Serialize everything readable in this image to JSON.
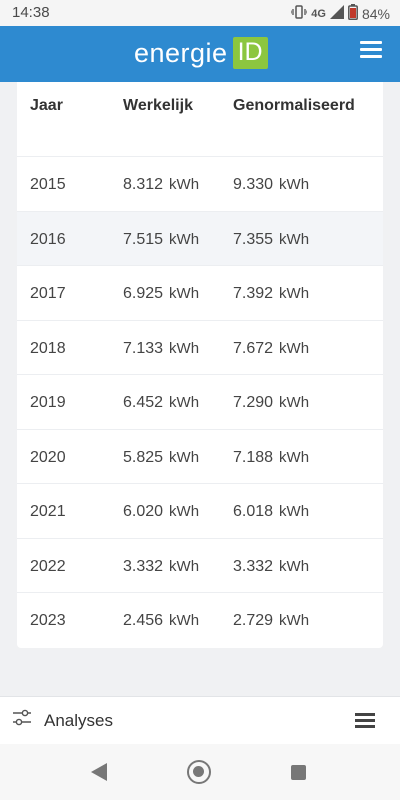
{
  "status_bar": {
    "time": "14:38",
    "network": "4G",
    "battery": "84%",
    "icons": [
      "vibrate-icon",
      "signal-icon",
      "battery-icon"
    ]
  },
  "header": {
    "logo_word": "energie",
    "logo_badge": "ID",
    "brand_color": "#2e8ad0",
    "badge_color": "#8cc63f"
  },
  "table": {
    "headers": [
      "Jaar",
      "Werkelijk",
      "Genormaliseerd"
    ],
    "unit": "kWh",
    "rows": [
      {
        "year": "2015",
        "actual": "8.312",
        "normalized": "9.330"
      },
      {
        "year": "2016",
        "actual": "7.515",
        "normalized": "7.355"
      },
      {
        "year": "2017",
        "actual": "6.925",
        "normalized": "7.392"
      },
      {
        "year": "2018",
        "actual": "7.133",
        "normalized": "7.672"
      },
      {
        "year": "2019",
        "actual": "6.452",
        "normalized": "7.290"
      },
      {
        "year": "2020",
        "actual": "5.825",
        "normalized": "7.188"
      },
      {
        "year": "2021",
        "actual": "6.020",
        "normalized": "6.018"
      },
      {
        "year": "2022",
        "actual": "3.332",
        "normalized": "3.332"
      },
      {
        "year": "2023",
        "actual": "2.456",
        "normalized": "2.729"
      }
    ]
  },
  "bottom_bar": {
    "label": "Analyses"
  }
}
